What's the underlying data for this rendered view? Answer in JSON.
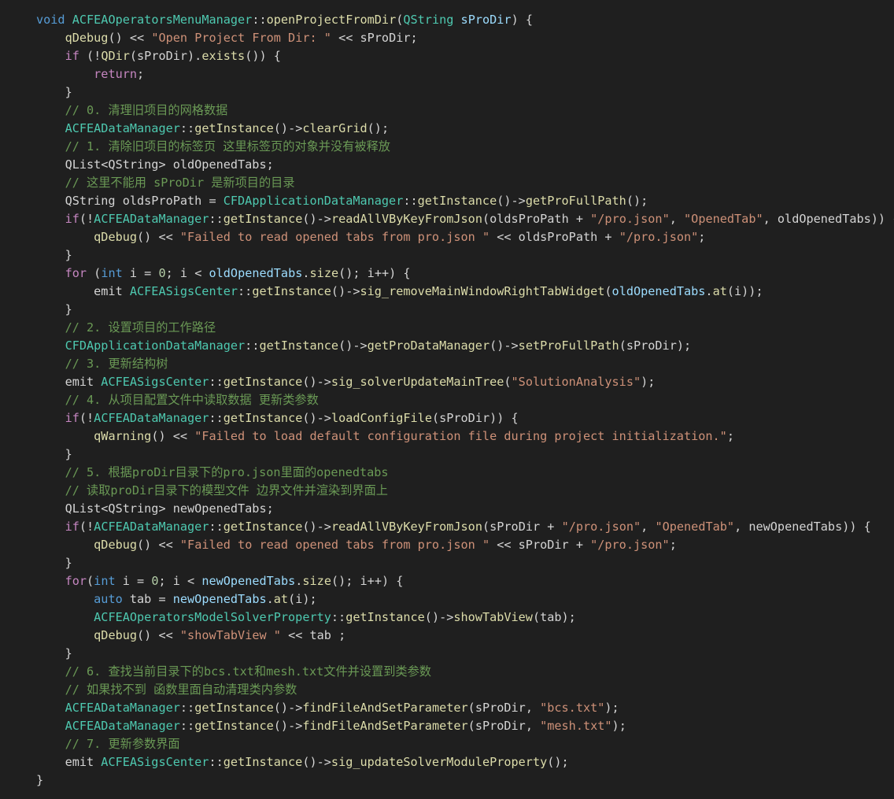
{
  "editor": {
    "colors": {
      "background": "#1f1f1f",
      "keyword": "#569cd6",
      "control": "#c586c0",
      "type": "#4ec9b0",
      "function": "#dcdcaa",
      "variable": "#9cdcfe",
      "string": "#ce9178",
      "number": "#b5cea8",
      "comment": "#6a9955",
      "plain": "#d4d4d4"
    },
    "lines": [
      [
        [
          "kw",
          "void"
        ],
        [
          "p",
          " "
        ],
        [
          "type",
          "ACFEAOperatorsMenuManager"
        ],
        [
          "p",
          "::"
        ],
        [
          "fn",
          "openProjectFromDir"
        ],
        [
          "p",
          "("
        ],
        [
          "type",
          "QString"
        ],
        [
          "p",
          " "
        ],
        [
          "var",
          "sProDir"
        ],
        [
          "p",
          ") {"
        ]
      ],
      [
        [
          "p",
          "    "
        ],
        [
          "fn",
          "qDebug"
        ],
        [
          "p",
          "() << "
        ],
        [
          "str",
          "\"Open Project From Dir: \""
        ],
        [
          "p",
          " << sProDir;"
        ]
      ],
      [
        [
          "p",
          "    "
        ],
        [
          "ctrl",
          "if"
        ],
        [
          "p",
          " (!"
        ],
        [
          "fn",
          "QDir"
        ],
        [
          "p",
          "(sProDir)."
        ],
        [
          "fn",
          "exists"
        ],
        [
          "p",
          "()) {"
        ]
      ],
      [
        [
          "p",
          "        "
        ],
        [
          "ctrl",
          "return"
        ],
        [
          "p",
          ";"
        ]
      ],
      [
        [
          "p",
          "    }"
        ]
      ],
      [
        [
          "p",
          "    "
        ],
        [
          "cmt",
          "// 0. 清理旧项目的网格数据"
        ]
      ],
      [
        [
          "p",
          "    "
        ],
        [
          "type",
          "ACFEADataManager"
        ],
        [
          "p",
          "::"
        ],
        [
          "fn",
          "getInstance"
        ],
        [
          "p",
          "()->"
        ],
        [
          "fn",
          "clearGrid"
        ],
        [
          "p",
          "();"
        ]
      ],
      [
        [
          "p",
          "    "
        ],
        [
          "cmt",
          "// 1. 清除旧项目的标签页 这里标签页的对象并没有被释放"
        ]
      ],
      [
        [
          "p",
          "    QList<QString> oldOpenedTabs;"
        ]
      ],
      [
        [
          "p",
          "    "
        ],
        [
          "cmt",
          "// 这里不能用 sProDir 是新项目的目录"
        ]
      ],
      [
        [
          "p",
          "    QString oldsProPath = "
        ],
        [
          "type",
          "CFDApplicationDataManager"
        ],
        [
          "p",
          "::"
        ],
        [
          "fn",
          "getInstance"
        ],
        [
          "p",
          "()->"
        ],
        [
          "fn",
          "getProFullPath"
        ],
        [
          "p",
          "();"
        ]
      ],
      [
        [
          "p",
          "    "
        ],
        [
          "ctrl",
          "if"
        ],
        [
          "p",
          "(!"
        ],
        [
          "type",
          "ACFEADataManager"
        ],
        [
          "p",
          "::"
        ],
        [
          "fn",
          "getInstance"
        ],
        [
          "p",
          "()->"
        ],
        [
          "fn",
          "readAllVByKeyFromJson"
        ],
        [
          "p",
          "(oldsProPath + "
        ],
        [
          "str",
          "\"/pro.json\""
        ],
        [
          "p",
          ", "
        ],
        [
          "str",
          "\"OpenedTab\""
        ],
        [
          "p",
          ", oldOpenedTabs)) {"
        ]
      ],
      [
        [
          "p",
          "        "
        ],
        [
          "fn",
          "qDebug"
        ],
        [
          "p",
          "() << "
        ],
        [
          "str",
          "\"Failed to read opened tabs from pro.json \""
        ],
        [
          "p",
          " << oldsProPath + "
        ],
        [
          "str",
          "\"/pro.json\""
        ],
        [
          "p",
          ";"
        ]
      ],
      [
        [
          "p",
          "    }"
        ]
      ],
      [
        [
          "p",
          "    "
        ],
        [
          "ctrl",
          "for"
        ],
        [
          "p",
          " ("
        ],
        [
          "kw",
          "int"
        ],
        [
          "p",
          " i = "
        ],
        [
          "num",
          "0"
        ],
        [
          "p",
          "; i < "
        ],
        [
          "var",
          "oldOpenedTabs"
        ],
        [
          "p",
          "."
        ],
        [
          "fn",
          "size"
        ],
        [
          "p",
          "(); i++) {"
        ]
      ],
      [
        [
          "p",
          "        emit "
        ],
        [
          "type",
          "ACFEASigsCenter"
        ],
        [
          "p",
          "::"
        ],
        [
          "fn",
          "getInstance"
        ],
        [
          "p",
          "()->"
        ],
        [
          "fn",
          "sig_removeMainWindowRightTabWidget"
        ],
        [
          "p",
          "("
        ],
        [
          "var",
          "oldOpenedTabs"
        ],
        [
          "p",
          "."
        ],
        [
          "fn",
          "at"
        ],
        [
          "p",
          "(i));"
        ]
      ],
      [
        [
          "p",
          "    }"
        ]
      ],
      [
        [
          "p",
          "    "
        ],
        [
          "cmt",
          "// 2. 设置项目的工作路径"
        ]
      ],
      [
        [
          "p",
          "    "
        ],
        [
          "type",
          "CFDApplicationDataManager"
        ],
        [
          "p",
          "::"
        ],
        [
          "fn",
          "getInstance"
        ],
        [
          "p",
          "()->"
        ],
        [
          "fn",
          "getProDataManager"
        ],
        [
          "p",
          "()->"
        ],
        [
          "fn",
          "setProFullPath"
        ],
        [
          "p",
          "(sProDir);"
        ]
      ],
      [
        [
          "p",
          "    "
        ],
        [
          "cmt",
          "// 3. 更新结构树"
        ]
      ],
      [
        [
          "p",
          "    emit "
        ],
        [
          "type",
          "ACFEASigsCenter"
        ],
        [
          "p",
          "::"
        ],
        [
          "fn",
          "getInstance"
        ],
        [
          "p",
          "()->"
        ],
        [
          "fn",
          "sig_solverUpdateMainTree"
        ],
        [
          "p",
          "("
        ],
        [
          "str",
          "\"SolutionAnalysis\""
        ],
        [
          "p",
          ");"
        ]
      ],
      [
        [
          "p",
          "    "
        ],
        [
          "cmt",
          "// 4. 从项目配置文件中读取数据 更新类参数"
        ]
      ],
      [
        [
          "p",
          "    "
        ],
        [
          "ctrl",
          "if"
        ],
        [
          "p",
          "(!"
        ],
        [
          "type",
          "ACFEADataManager"
        ],
        [
          "p",
          "::"
        ],
        [
          "fn",
          "getInstance"
        ],
        [
          "p",
          "()->"
        ],
        [
          "fn",
          "loadConfigFile"
        ],
        [
          "p",
          "(sProDir)) {"
        ]
      ],
      [
        [
          "p",
          "        "
        ],
        [
          "fn",
          "qWarning"
        ],
        [
          "p",
          "() << "
        ],
        [
          "str",
          "\"Failed to load default configuration file during project initialization.\""
        ],
        [
          "p",
          ";"
        ]
      ],
      [
        [
          "p",
          "    }"
        ]
      ],
      [
        [
          "p",
          "    "
        ],
        [
          "cmt",
          "// 5. 根据proDir目录下的pro.json里面的openedtabs"
        ]
      ],
      [
        [
          "p",
          "    "
        ],
        [
          "cmt",
          "// 读取proDir目录下的模型文件 边界文件并渲染到界面上"
        ]
      ],
      [
        [
          "p",
          "    QList<QString> newOpenedTabs;"
        ]
      ],
      [
        [
          "p",
          "    "
        ],
        [
          "ctrl",
          "if"
        ],
        [
          "p",
          "(!"
        ],
        [
          "type",
          "ACFEADataManager"
        ],
        [
          "p",
          "::"
        ],
        [
          "fn",
          "getInstance"
        ],
        [
          "p",
          "()->"
        ],
        [
          "fn",
          "readAllVByKeyFromJson"
        ],
        [
          "p",
          "(sProDir + "
        ],
        [
          "str",
          "\"/pro.json\""
        ],
        [
          "p",
          ", "
        ],
        [
          "str",
          "\"OpenedTab\""
        ],
        [
          "p",
          ", newOpenedTabs)) {"
        ]
      ],
      [
        [
          "p",
          "        "
        ],
        [
          "fn",
          "qDebug"
        ],
        [
          "p",
          "() << "
        ],
        [
          "str",
          "\"Failed to read opened tabs from pro.json \""
        ],
        [
          "p",
          " << sProDir + "
        ],
        [
          "str",
          "\"/pro.json\""
        ],
        [
          "p",
          ";"
        ]
      ],
      [
        [
          "p",
          "    }"
        ]
      ],
      [
        [
          "p",
          "    "
        ],
        [
          "ctrl",
          "for"
        ],
        [
          "p",
          "("
        ],
        [
          "kw",
          "int"
        ],
        [
          "p",
          " i = "
        ],
        [
          "num",
          "0"
        ],
        [
          "p",
          "; i < "
        ],
        [
          "var",
          "newOpenedTabs"
        ],
        [
          "p",
          "."
        ],
        [
          "fn",
          "size"
        ],
        [
          "p",
          "(); i++) {"
        ]
      ],
      [
        [
          "p",
          "        "
        ],
        [
          "kw",
          "auto"
        ],
        [
          "p",
          " tab = "
        ],
        [
          "var",
          "newOpenedTabs"
        ],
        [
          "p",
          "."
        ],
        [
          "fn",
          "at"
        ],
        [
          "p",
          "(i);"
        ]
      ],
      [
        [
          "p",
          "        "
        ],
        [
          "type",
          "ACFEAOperatorsModelSolverProperty"
        ],
        [
          "p",
          "::"
        ],
        [
          "fn",
          "getInstance"
        ],
        [
          "p",
          "()->"
        ],
        [
          "fn",
          "showTabView"
        ],
        [
          "p",
          "(tab);"
        ]
      ],
      [
        [
          "p",
          "        "
        ],
        [
          "fn",
          "qDebug"
        ],
        [
          "p",
          "() << "
        ],
        [
          "str",
          "\"showTabView \""
        ],
        [
          "p",
          " << tab ;"
        ]
      ],
      [
        [
          "p",
          "    }"
        ]
      ],
      [
        [
          "p",
          "    "
        ],
        [
          "cmt",
          "// 6. 查找当前目录下的bcs.txt和mesh.txt文件并设置到类参数"
        ]
      ],
      [
        [
          "p",
          "    "
        ],
        [
          "cmt",
          "// 如果找不到 函数里面自动清理类内参数"
        ]
      ],
      [
        [
          "p",
          "    "
        ],
        [
          "type",
          "ACFEADataManager"
        ],
        [
          "p",
          "::"
        ],
        [
          "fn",
          "getInstance"
        ],
        [
          "p",
          "()->"
        ],
        [
          "fn",
          "findFileAndSetParameter"
        ],
        [
          "p",
          "(sProDir, "
        ],
        [
          "str",
          "\"bcs.txt\""
        ],
        [
          "p",
          ");"
        ]
      ],
      [
        [
          "p",
          "    "
        ],
        [
          "type",
          "ACFEADataManager"
        ],
        [
          "p",
          "::"
        ],
        [
          "fn",
          "getInstance"
        ],
        [
          "p",
          "()->"
        ],
        [
          "fn",
          "findFileAndSetParameter"
        ],
        [
          "p",
          "(sProDir, "
        ],
        [
          "str",
          "\"mesh.txt\""
        ],
        [
          "p",
          ");"
        ]
      ],
      [
        [
          "p",
          "    "
        ],
        [
          "cmt",
          "// 7. 更新参数界面"
        ]
      ],
      [
        [
          "p",
          "    emit "
        ],
        [
          "type",
          "ACFEASigsCenter"
        ],
        [
          "p",
          "::"
        ],
        [
          "fn",
          "getInstance"
        ],
        [
          "p",
          "()->"
        ],
        [
          "fn",
          "sig_updateSolverModuleProperty"
        ],
        [
          "p",
          "();"
        ]
      ],
      [
        [
          "p",
          "}"
        ]
      ]
    ]
  }
}
